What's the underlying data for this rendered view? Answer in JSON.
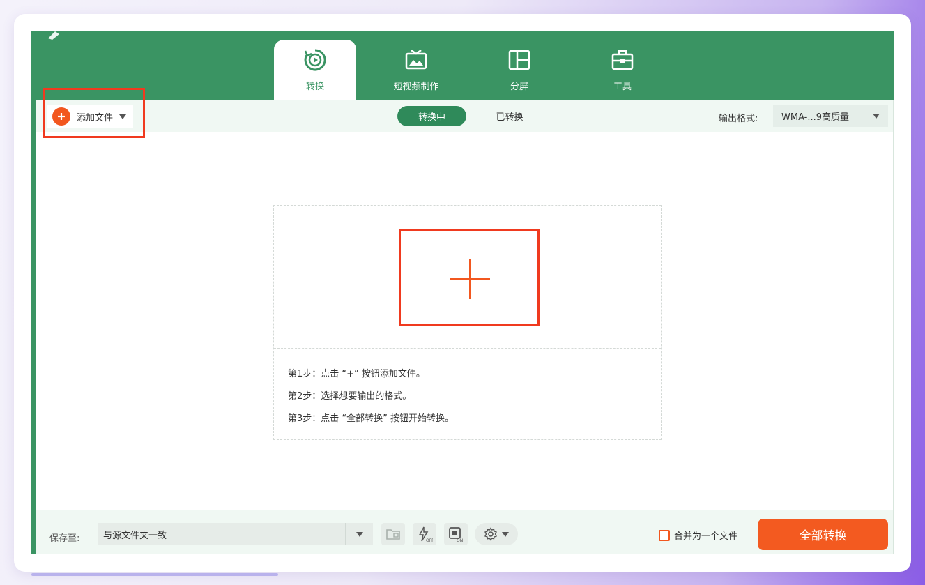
{
  "tabs": [
    {
      "label": "转换",
      "icon": "convert-icon",
      "active": true
    },
    {
      "label": "短视频制作",
      "icon": "video-maker-icon",
      "active": false
    },
    {
      "label": "分屏",
      "icon": "split-screen-icon",
      "active": false
    },
    {
      "label": "工具",
      "icon": "toolbox-icon",
      "active": false
    }
  ],
  "toolbar": {
    "add_file": "添加文件",
    "converting": "转换中",
    "converted": "已转换",
    "output_format_label": "输出格式:",
    "output_format_value": "WMA-...9高质量"
  },
  "steps": [
    "第1步：点击 “+” 按钮添加文件。",
    "第2步：选择想要输出的格式。",
    "第3步：点击 “全部转换” 按钮开始转换。"
  ],
  "bottom": {
    "save_label": "保存至:",
    "save_path": "与源文件夹一致",
    "merge_label": "合并为一个文件",
    "convert_all": "全部转换"
  },
  "colors": {
    "brand_green": "#3a9463",
    "accent_orange": "#f2571f",
    "highlight_red": "#f03a1f"
  }
}
